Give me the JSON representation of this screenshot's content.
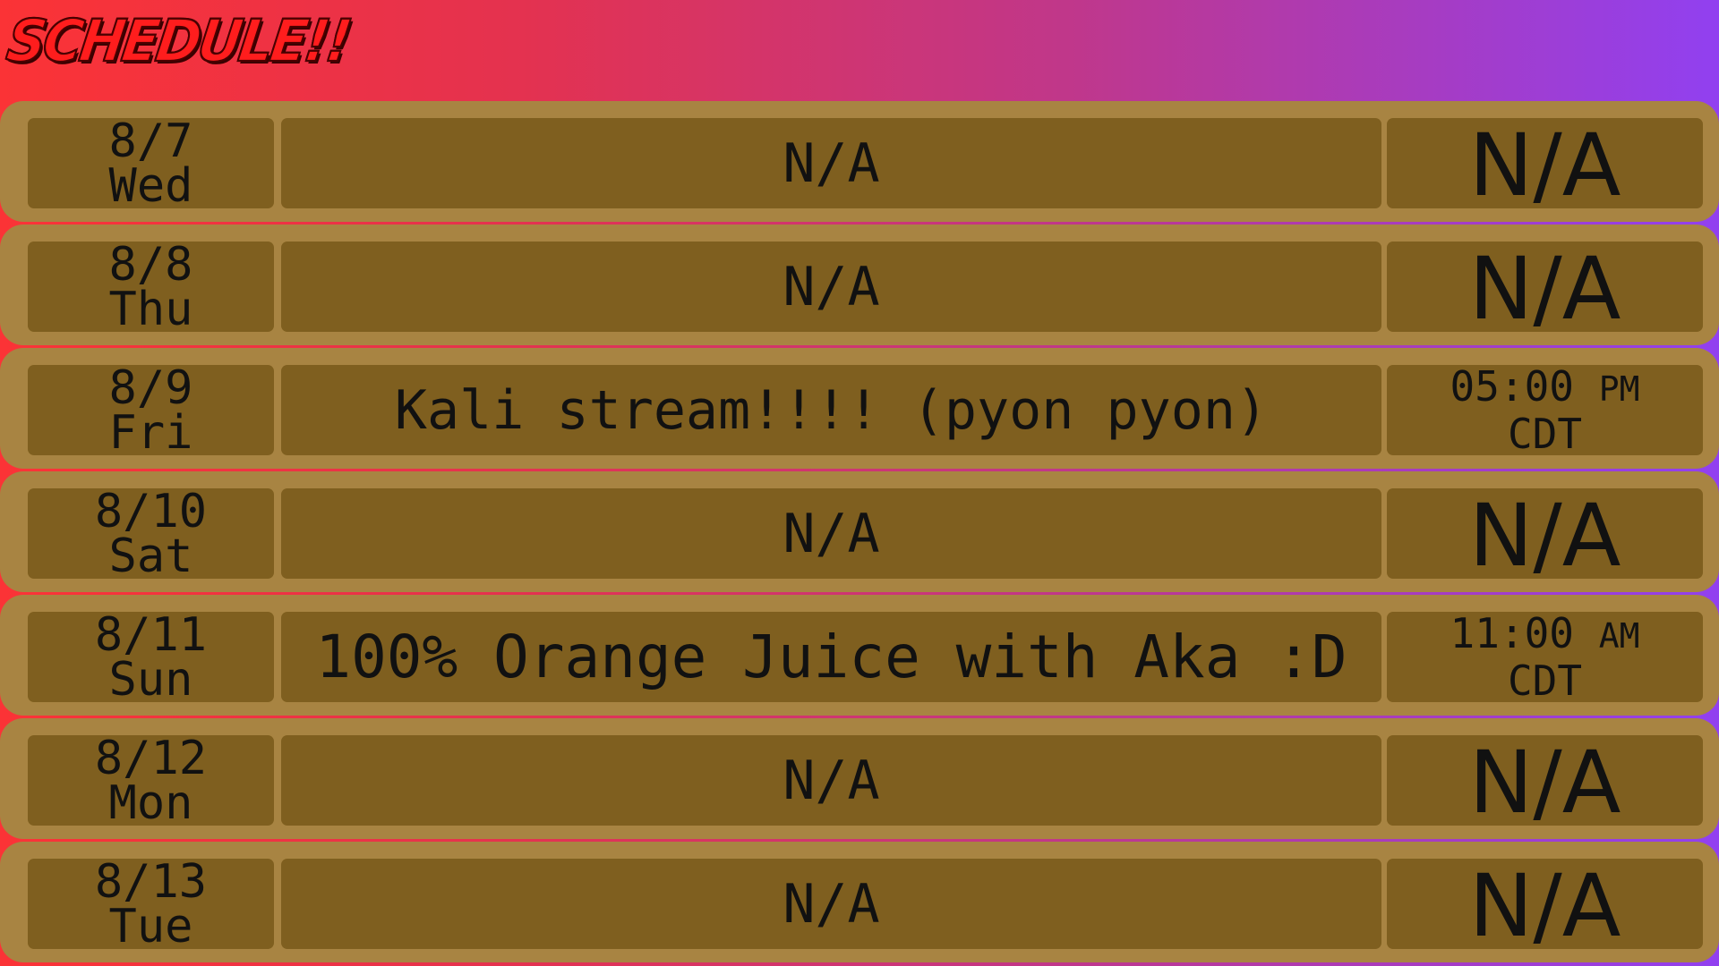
{
  "header": {
    "title": "SCHEDULE!!"
  },
  "colors": {
    "gradient_start": "#fb3336",
    "gradient_end": "#9140f0",
    "row_frame": "#a88442",
    "cell_fill": "#7f5f1f",
    "title_red": "#ff1d1d"
  },
  "schedule": [
    {
      "date": "8/7",
      "day": "Wed",
      "event": "N/A",
      "time": "",
      "ampm": "",
      "tz": "",
      "time_na": "N/A"
    },
    {
      "date": "8/8",
      "day": "Thu",
      "event": "N/A",
      "time": "",
      "ampm": "",
      "tz": "",
      "time_na": "N/A"
    },
    {
      "date": "8/9",
      "day": "Fri",
      "event": "Kali stream!!!! (pyon pyon)",
      "time": "05:00",
      "ampm": "PM",
      "tz": "CDT",
      "time_na": ""
    },
    {
      "date": "8/10",
      "day": "Sat",
      "event": "N/A",
      "time": "",
      "ampm": "",
      "tz": "",
      "time_na": "N/A"
    },
    {
      "date": "8/11",
      "day": "Sun",
      "event": "100% Orange Juice with Aka :D",
      "time": "11:00",
      "ampm": "AM",
      "tz": "CDT",
      "time_na": ""
    },
    {
      "date": "8/12",
      "day": "Mon",
      "event": "N/A",
      "time": "",
      "ampm": "",
      "tz": "",
      "time_na": "N/A"
    },
    {
      "date": "8/13",
      "day": "Tue",
      "event": "N/A",
      "time": "",
      "ampm": "",
      "tz": "",
      "time_na": "N/A"
    }
  ]
}
